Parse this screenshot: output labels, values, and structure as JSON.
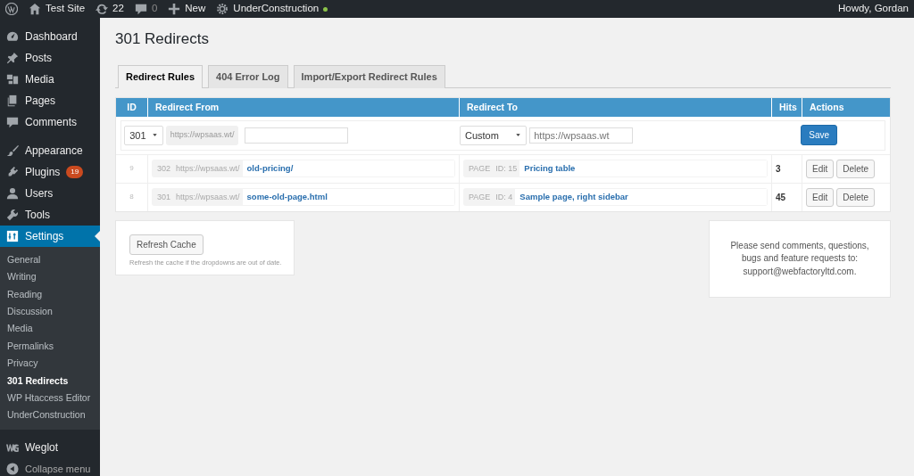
{
  "admin_bar": {
    "site": "Test Site",
    "updates": "22",
    "comments": "0",
    "new": "New",
    "plugin": "UnderConstruction",
    "greeting": "Howdy, Gordan"
  },
  "sidebar": {
    "items": [
      {
        "label": "Dashboard",
        "selected": false
      },
      {
        "label": "Posts",
        "selected": false
      },
      {
        "label": "Media",
        "selected": false
      },
      {
        "label": "Pages",
        "selected": false
      },
      {
        "label": "Comments",
        "selected": false
      },
      {
        "label": "Appearance",
        "selected": false
      },
      {
        "label": "Plugins",
        "selected": false,
        "badge": "19"
      },
      {
        "label": "Users",
        "selected": false
      },
      {
        "label": "Tools",
        "selected": false
      },
      {
        "label": "Settings",
        "selected": true,
        "children": [
          {
            "label": "General",
            "selected": false
          },
          {
            "label": "Writing",
            "selected": false
          },
          {
            "label": "Reading",
            "selected": false
          },
          {
            "label": "Discussion",
            "selected": false
          },
          {
            "label": "Media",
            "selected": false
          },
          {
            "label": "Permalinks",
            "selected": false
          },
          {
            "label": "Privacy",
            "selected": false
          },
          {
            "label": "301 Redirects",
            "selected": true
          },
          {
            "label": "WP Htaccess Editor",
            "selected": false
          },
          {
            "label": "UnderConstruction",
            "selected": false
          }
        ]
      },
      {
        "label": "Weglot",
        "selected": false
      },
      {
        "label": "Collapse menu",
        "selected": false
      }
    ]
  },
  "page_title": "301 Redirects",
  "tabs": [
    {
      "label": "Redirect Rules",
      "selected": true
    },
    {
      "label": "404 Error Log",
      "selected": false
    },
    {
      "label": "Import/Export Redirect Rules",
      "selected": false
    }
  ],
  "table": {
    "columns": [
      "ID",
      "Redirect From",
      "Redirect To",
      "Hits",
      "Actions"
    ],
    "new_rule": {
      "status": "301",
      "base": "https://wpsaas.wt/",
      "target_type": "Custom",
      "target_placeholder": "https://wpsaas.wt",
      "save": "Save"
    },
    "rows": [
      {
        "id": "9",
        "status": "302",
        "base": "https://wpsaas.wt/",
        "from": "old-pricing/",
        "to_type": "PAGE",
        "to_id": "ID: 15",
        "to_title": "Pricing table",
        "hits": "3",
        "actions": [
          "Edit",
          "Delete"
        ]
      },
      {
        "id": "8",
        "status": "301",
        "base": "https://wpsaas.wt/",
        "from": "some-old-page.html",
        "to_type": "PAGE",
        "to_id": "ID: 4",
        "to_title": "Sample page, right sidebar",
        "hits": "45",
        "actions": [
          "Edit",
          "Delete"
        ]
      }
    ]
  },
  "refresh": {
    "button": "Refresh Cache",
    "hint": "Refresh the cache if the dropdowns are out of date."
  },
  "support": {
    "text": "Please send comments, questions, bugs and feature requests to: ",
    "link": "support@webfactoryltd.com",
    "after": "."
  }
}
